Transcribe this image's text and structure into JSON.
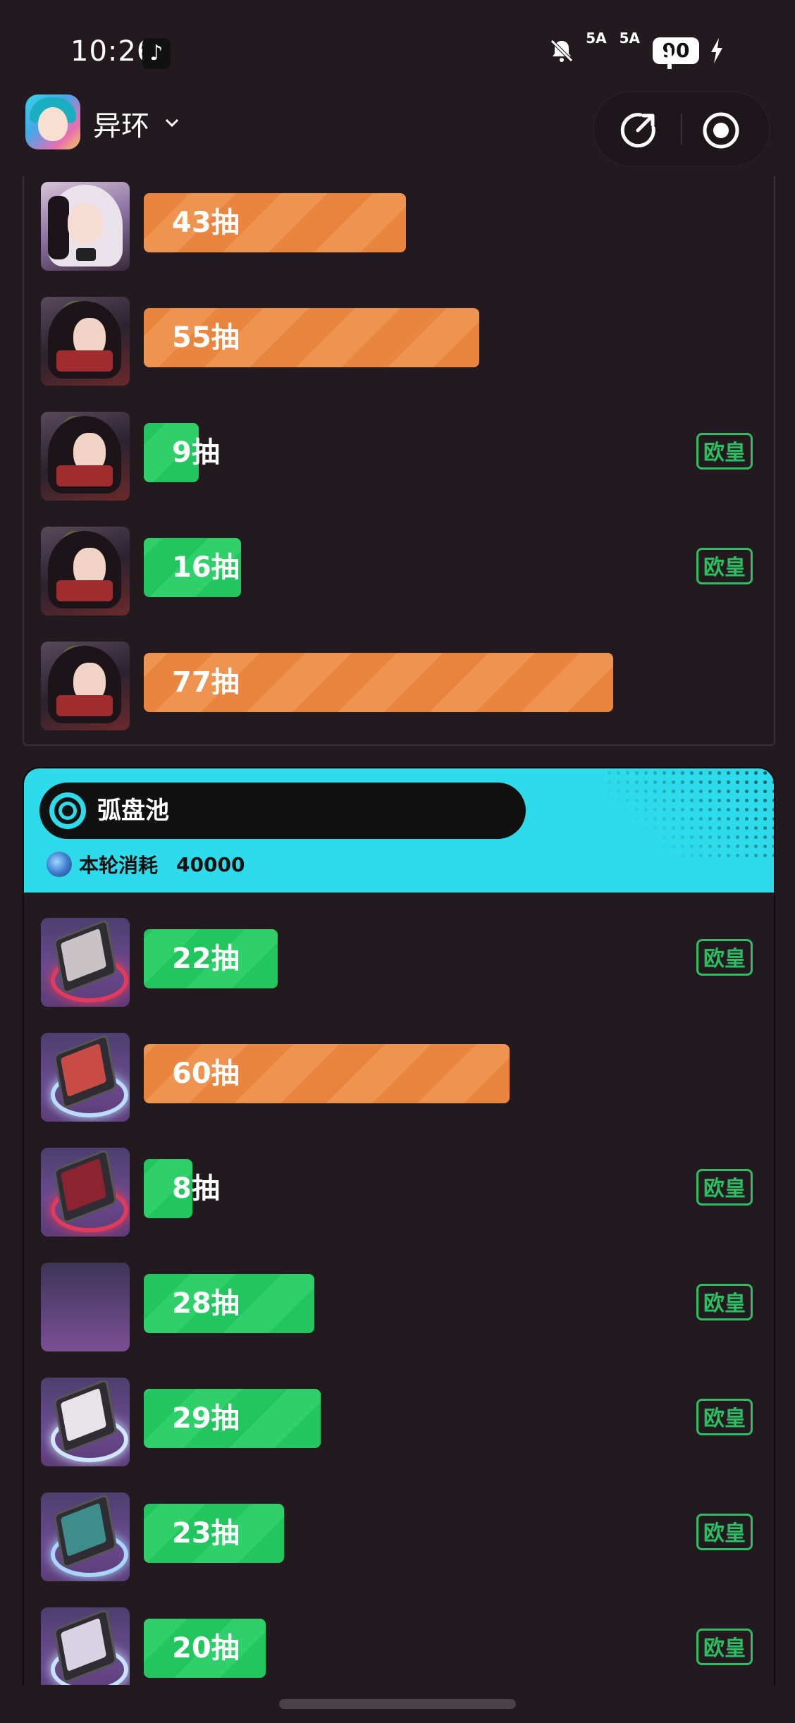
{
  "status_bar": {
    "time": "10:26",
    "network1": "5A",
    "network2": "5A",
    "battery": "90"
  },
  "header": {
    "app_name": "异环"
  },
  "panel1": {
    "rows": [
      {
        "label": "43抽",
        "pulls": 43,
        "color": "orange",
        "thumb": "char2",
        "badge": ""
      },
      {
        "label": "55抽",
        "pulls": 55,
        "color": "orange",
        "thumb": "char",
        "badge": ""
      },
      {
        "label": "9抽",
        "pulls": 9,
        "color": "green",
        "thumb": "char",
        "badge": "欧皇"
      },
      {
        "label": "16抽",
        "pulls": 16,
        "color": "green",
        "thumb": "char",
        "badge": "欧皇"
      },
      {
        "label": "77抽",
        "pulls": 77,
        "color": "orange",
        "thumb": "char",
        "badge": ""
      }
    ]
  },
  "pool": {
    "title": "弧盘池",
    "cost_label": "本轮消耗",
    "cost_value": "40000",
    "rows": [
      {
        "label": "22抽",
        "pulls": 22,
        "color": "green",
        "thumb": "disc",
        "ring": "#e23a5a",
        "art": "#c9c3c6",
        "badge": "欧皇"
      },
      {
        "label": "60抽",
        "pulls": 60,
        "color": "orange",
        "thumb": "disc",
        "ring": "#b9dcff",
        "art": "#c84c45",
        "badge": ""
      },
      {
        "label": "8抽",
        "pulls": 8,
        "color": "green",
        "thumb": "disc",
        "ring": "#e23a5a",
        "art": "#8a2430",
        "badge": "欧皇"
      },
      {
        "label": "28抽",
        "pulls": 28,
        "color": "green",
        "thumb": "blank",
        "badge": "欧皇"
      },
      {
        "label": "29抽",
        "pulls": 29,
        "color": "green",
        "thumb": "disc",
        "ring": "#cfe6ff",
        "art": "#e8e3e6",
        "badge": "欧皇"
      },
      {
        "label": "23抽",
        "pulls": 23,
        "color": "green",
        "thumb": "disc",
        "ring": "#a8d4ff",
        "art": "#3d8d8c",
        "badge": "欧皇"
      },
      {
        "label": "20抽",
        "pulls": 20,
        "color": "green",
        "thumb": "disc",
        "ring": "#c7e3ff",
        "art": "#d9d2e2",
        "badge": "欧皇"
      }
    ]
  }
}
